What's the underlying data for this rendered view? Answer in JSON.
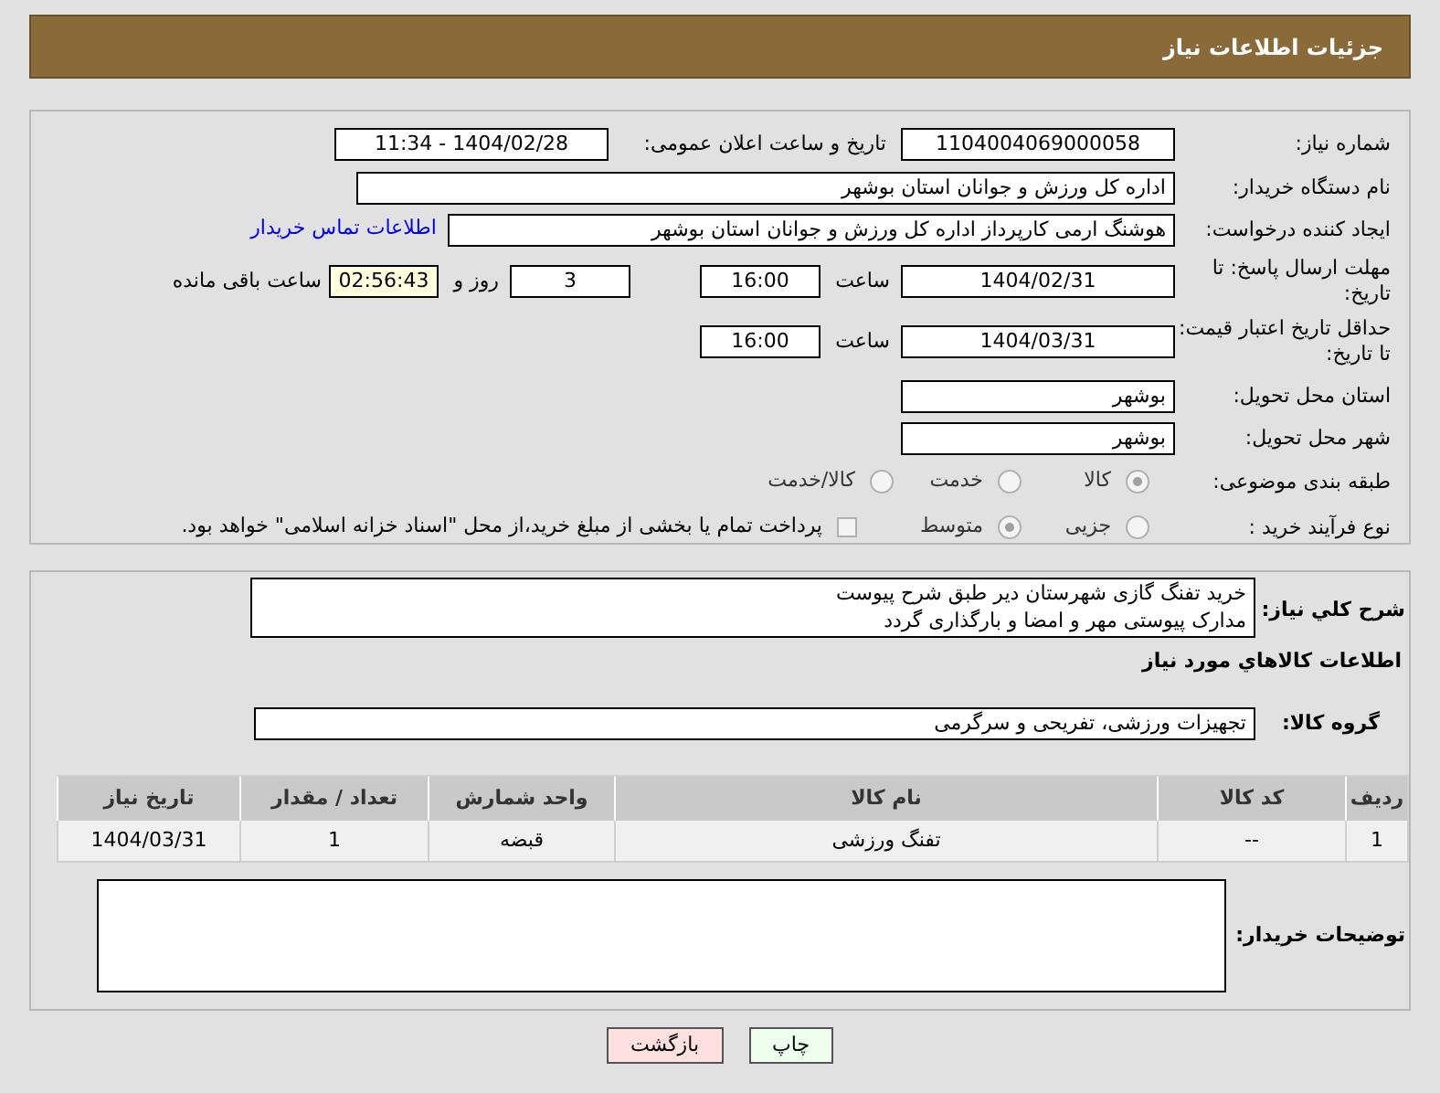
{
  "header": {
    "title": "جزئیات اطلاعات نیاز"
  },
  "need_number": {
    "label": "شماره نیاز:",
    "value": "1104004069000058"
  },
  "announce": {
    "label": "تاریخ و ساعت اعلان عمومی:",
    "value": "1404/02/28 - 11:34"
  },
  "buyer": {
    "label": "نام دستگاه خریدار:",
    "value": "اداره کل ورزش و جوانان استان بوشهر"
  },
  "requester": {
    "label": "ایجاد کننده درخواست:",
    "value": "هوشنگ ارمی کارپرداز اداره کل ورزش و جوانان استان بوشهر",
    "link": "اطلاعات تماس خریدار"
  },
  "deadline": {
    "label": "مهلت ارسال پاسخ: تا تاریخ:",
    "date": "1404/02/31",
    "time_label": "ساعت",
    "time": "16:00",
    "days": "3",
    "days_label": "روز و",
    "remaining": "02:56:43",
    "remaining_label": "ساعت باقی مانده"
  },
  "validity": {
    "label": "حداقل تاریخ اعتبار قیمت: تا تاریخ:",
    "date": "1404/03/31",
    "time_label": "ساعت",
    "time": "16:00"
  },
  "province": {
    "label": "استان محل تحویل:",
    "value": "بوشهر"
  },
  "city": {
    "label": "شهر محل تحویل:",
    "value": "بوشهر"
  },
  "category": {
    "label": "طبقه بندی موضوعی:",
    "options": [
      {
        "label": "کالا",
        "selected": true
      },
      {
        "label": "خدمت",
        "selected": false
      },
      {
        "label": "کالا/خدمت",
        "selected": false
      }
    ]
  },
  "process": {
    "label": "نوع فرآیند خرید :",
    "options": [
      {
        "label": "جزیی",
        "selected": false
      },
      {
        "label": "متوسط",
        "selected": true
      }
    ],
    "payment": {
      "label": "پرداخت تمام یا بخشی از مبلغ خرید،از محل \"اسناد خزانه اسلامی\" خواهد بود.",
      "checked": false
    }
  },
  "description": {
    "label": "شرح کلي نياز:",
    "lines": [
      "خرید تفنگ گازی شهرستان دیر طبق شرح پیوست",
      "مدارک پیوستی مهر و امضا و بارگذاری گردد"
    ]
  },
  "goods_title": "اطلاعات کالاهاي مورد نياز",
  "goods_group": {
    "label": "گروه کالا:",
    "value": "تجهیزات ورزشی، تفریحی و سرگرمی"
  },
  "table": {
    "columns": [
      "ردیف",
      "کد کالا",
      "نام کالا",
      "واحد شمارش",
      "تعداد / مقدار",
      "تاریخ نیاز"
    ],
    "rows": [
      [
        "1",
        "--",
        "تفنگ ورزشی",
        "قبضه",
        "1",
        "1404/03/31"
      ]
    ]
  },
  "buyer_notes": {
    "label": "توضیحات خریدار:"
  },
  "buttons": [
    {
      "label": "چاپ",
      "kind": "print"
    },
    {
      "label": "بازگشت",
      "kind": "back"
    }
  ]
}
